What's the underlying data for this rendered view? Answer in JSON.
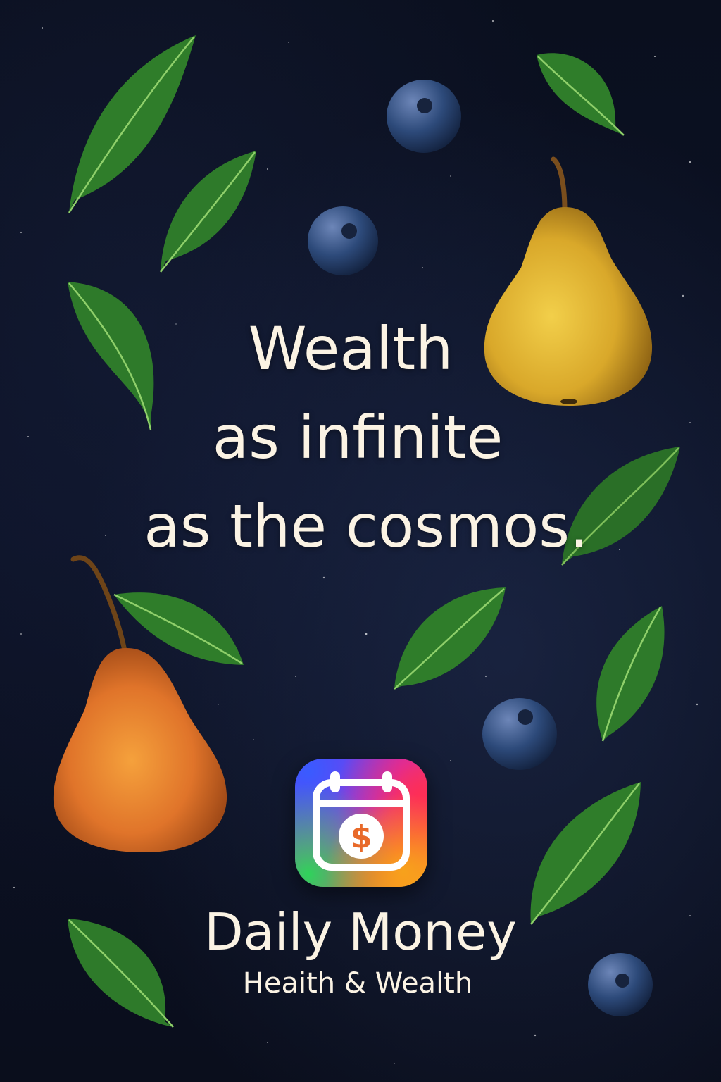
{
  "headline": {
    "line1": "Wealth",
    "line2": "as infinite",
    "line3": "as the cosmos."
  },
  "app": {
    "icon": "calendar-dollar-icon",
    "name": "Daily Money",
    "tagline": "Heaith & Wealth"
  },
  "decorations": {
    "icons": [
      "pear-icon",
      "blueberry-icon",
      "leaf-icon"
    ]
  },
  "colors": {
    "background": "#0b1020",
    "text": "#fbf3e4",
    "leaf": "#2f7d2a",
    "blueberry": "#2d4a7a",
    "pear_yellow": "#e3b732",
    "pear_orange": "#e27a24"
  }
}
